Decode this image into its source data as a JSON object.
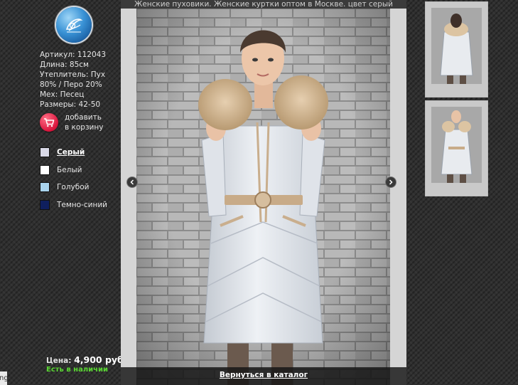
{
  "page": {
    "title": "Женские пуховики. Женские куртки оптом в Москве. цвет серый",
    "back_link": "Вернуться в каталог",
    "edge_tab": "ng"
  },
  "logo": {
    "icon": "logo-emblem-icon"
  },
  "specs": [
    "Артикул: 112043",
    "Длина: 85см",
    "Утеплитель: Пух",
    "80% / Перо 20%",
    "Мех: Песец",
    "Размеры: 42-50"
  ],
  "cart": {
    "label": "добавить в корзину",
    "icon": "shopping-cart-icon"
  },
  "colors": [
    {
      "label": "Серый",
      "hex": "#d8d8e6",
      "selected": true
    },
    {
      "label": "Белый",
      "hex": "#ffffff",
      "selected": false
    },
    {
      "label": "Голубой",
      "hex": "#a9d4ee",
      "selected": false
    },
    {
      "label": "Темно-синий",
      "hex": "#0f1f5e",
      "selected": false
    }
  ],
  "price": {
    "label": "Цена:",
    "amount": "4,900 руб."
  },
  "stock": {
    "label": "Есть в наличии",
    "color": "#59d632"
  },
  "gallery": {
    "prev_icon": "chevron-left-icon",
    "next_icon": "chevron-right-icon",
    "thumbnails": [
      {
        "view": "back"
      },
      {
        "view": "front"
      }
    ]
  }
}
